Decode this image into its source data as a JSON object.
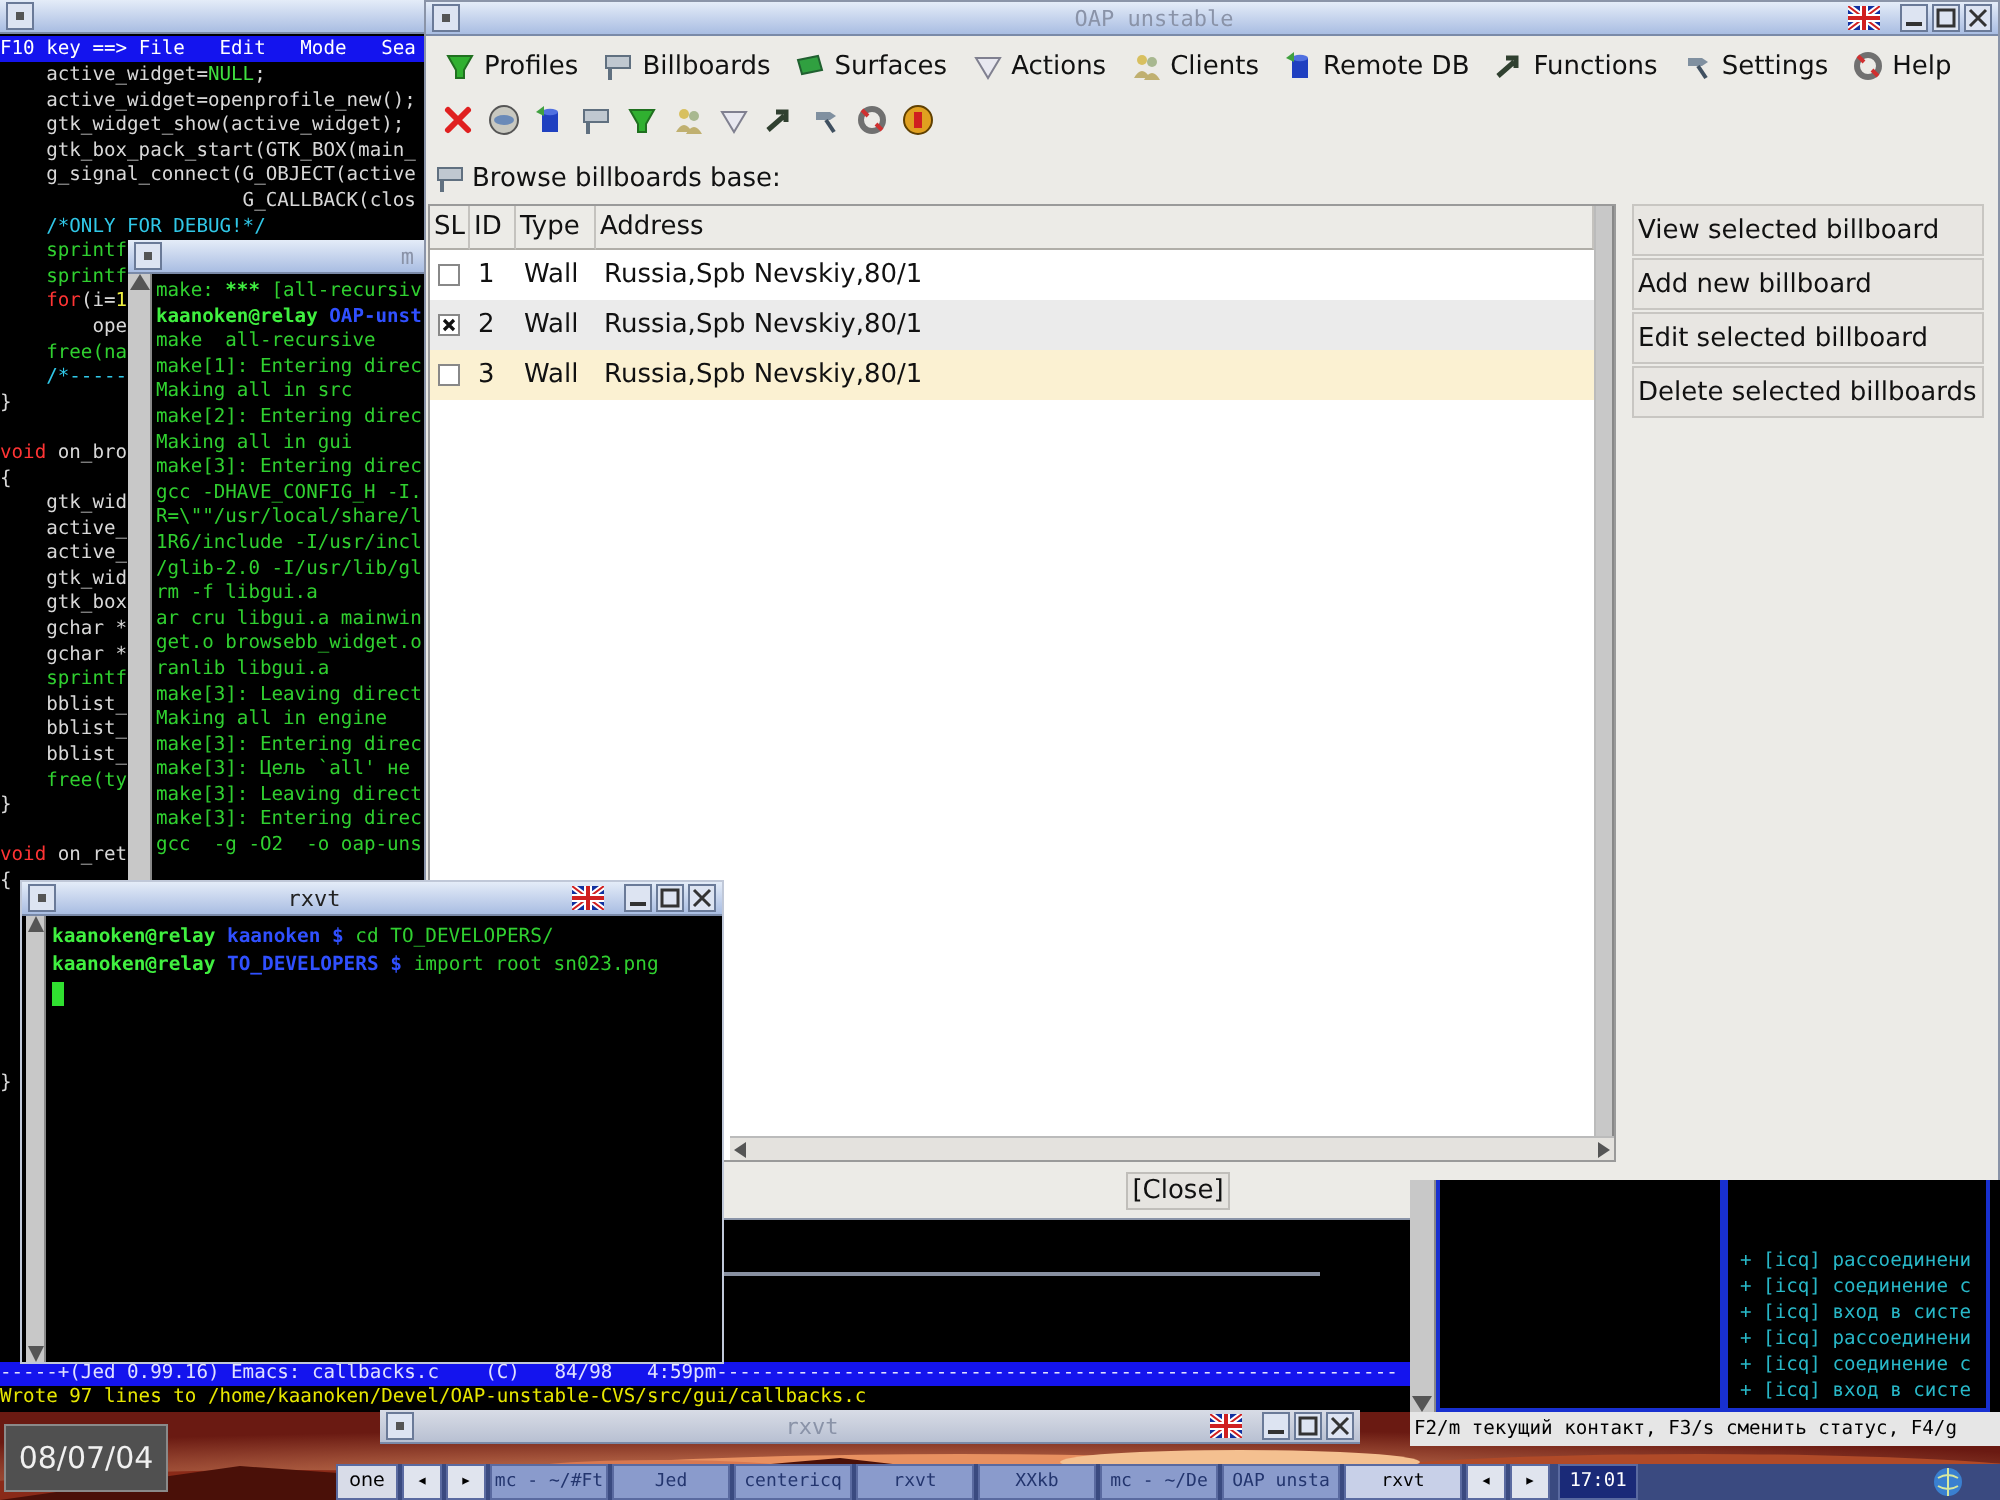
{
  "editor": {
    "menu_prefix": "F10 key ==>",
    "menu": [
      {
        "label": "File"
      },
      {
        "label": "Edit"
      },
      {
        "label": "Mode"
      },
      {
        "label": "Sea"
      }
    ],
    "code_blocks": [
      [
        {
          "parts": [
            {
              "text": "    active_widget=",
              "kind": "plain"
            },
            {
              "text": "NULL",
              "kind": "constant"
            },
            {
              "text": ";",
              "kind": "plain"
            }
          ]
        },
        {
          "parts": [
            {
              "text": "    active_widget=openprofile_new();",
              "kind": "plain"
            }
          ]
        },
        {
          "parts": [
            {
              "text": "    gtk_widget_show(active_widget);",
              "kind": "plain"
            }
          ]
        },
        {
          "parts": [
            {
              "text": "    gtk_box_pack_start(GTK_BOX(main_",
              "kind": "plain"
            }
          ]
        },
        {
          "parts": [
            {
              "text": "    g_signal_connect(G_OBJECT(active",
              "kind": "plain"
            }
          ]
        },
        {
          "parts": [
            {
              "text": "                     G_CALLBACK(clos",
              "kind": "plain"
            }
          ]
        },
        {
          "parts": [
            {
              "text": "    /*ONLY FOR DEBUG!*/",
              "kind": "comment"
            }
          ]
        },
        {
          "parts": [
            {
              "text": "    sprintf",
              "kind": "builtin"
            }
          ]
        },
        {
          "parts": [
            {
              "text": "    sprintf",
              "kind": "builtin"
            }
          ]
        },
        {
          "parts": [
            {
              "text": "    for",
              "kind": "keyword"
            },
            {
              "text": "(i=",
              "kind": "plain"
            },
            {
              "text": "1",
              "kind": "number"
            }
          ]
        },
        {
          "parts": [
            {
              "text": "        ope",
              "kind": "plain"
            }
          ]
        },
        {
          "parts": [
            {
              "text": "    free(na",
              "kind": "builtin"
            }
          ]
        },
        {
          "parts": [
            {
              "text": "    /*-----",
              "kind": "comment"
            }
          ]
        },
        {
          "parts": [
            {
              "text": "}",
              "kind": "plain"
            }
          ]
        }
      ],
      [
        {
          "parts": [
            {
              "text": "void",
              "kind": "keyword"
            },
            {
              "text": " on_bro",
              "kind": "plain"
            }
          ]
        },
        {
          "parts": [
            {
              "text": "{",
              "kind": "plain"
            }
          ]
        },
        {
          "parts": [
            {
              "text": "    gtk_wid",
              "kind": "plain"
            }
          ]
        },
        {
          "parts": [
            {
              "text": "    active_",
              "kind": "plain"
            }
          ]
        },
        {
          "parts": [
            {
              "text": "    active_",
              "kind": "plain"
            }
          ]
        },
        {
          "parts": [
            {
              "text": "    gtk_wid",
              "kind": "plain"
            }
          ]
        },
        {
          "parts": [
            {
              "text": "    gtk_box",
              "kind": "plain"
            }
          ]
        },
        {
          "parts": [
            {
              "text": "    gchar *",
              "kind": "plain"
            }
          ]
        },
        {
          "parts": [
            {
              "text": "    gchar *",
              "kind": "plain"
            }
          ]
        },
        {
          "parts": [
            {
              "text": "    sprintf",
              "kind": "builtin"
            }
          ]
        },
        {
          "parts": [
            {
              "text": "    bblist_",
              "kind": "plain"
            }
          ]
        },
        {
          "parts": [
            {
              "text": "    bblist_",
              "kind": "plain"
            }
          ]
        },
        {
          "parts": [
            {
              "text": "    bblist_",
              "kind": "plain"
            }
          ]
        },
        {
          "parts": [
            {
              "text": "    free(ty",
              "kind": "builtin"
            }
          ]
        },
        {
          "parts": [
            {
              "text": "}",
              "kind": "plain"
            }
          ]
        }
      ],
      [
        {
          "parts": [
            {
              "text": "void",
              "kind": "keyword"
            },
            {
              "text": " on_ret",
              "kind": "plain"
            }
          ]
        },
        {
          "parts": [
            {
              "text": "{",
              "kind": "plain"
            }
          ]
        }
      ],
      [
        {
          "parts": [
            {
              "text": "}",
              "kind": "plain"
            }
          ]
        }
      ]
    ],
    "status_line": "-----+(Jed 0.99.16) Emacs: callbacks.c    (C)   84/98   4:59pm-----------------------------------------------------------",
    "message": "Wrote 97 lines to /home/kaanoken/Devel/OAP-unstable-CVS/src/gui/callbacks.c"
  },
  "make_terminal": {
    "title": "m",
    "lines": [
      {
        "parts": [
          {
            "text": "make: ",
            "kind": "output"
          },
          {
            "text": "***",
            "kind": "bold"
          },
          {
            "text": " [all-recursiv",
            "kind": "output"
          }
        ]
      },
      {
        "parts": [
          {
            "text": "kaanoken@relay",
            "kind": "prompt"
          },
          {
            "text": " OAP-unst",
            "kind": "path"
          }
        ]
      },
      {
        "parts": [
          {
            "text": "make  all-recursive",
            "kind": "output"
          }
        ]
      },
      {
        "parts": [
          {
            "text": "make[1]: Entering direc",
            "kind": "output"
          }
        ]
      },
      {
        "parts": [
          {
            "text": "Making all in src",
            "kind": "output"
          }
        ]
      },
      {
        "parts": [
          {
            "text": "make[2]: Entering direc",
            "kind": "output"
          }
        ]
      },
      {
        "parts": [
          {
            "text": "Making all in gui",
            "kind": "output"
          }
        ]
      },
      {
        "parts": [
          {
            "text": "make[3]: Entering direc",
            "kind": "output"
          }
        ]
      },
      {
        "parts": [
          {
            "text": "gcc -DHAVE_CONFIG_H -I.",
            "kind": "output"
          }
        ]
      },
      {
        "parts": [
          {
            "text": "R=\\\"\"/usr/local/share/l",
            "kind": "output"
          }
        ]
      },
      {
        "parts": [
          {
            "text": "1R6/include -I/usr/incl",
            "kind": "output"
          }
        ]
      },
      {
        "parts": [
          {
            "text": "/glib-2.0 -I/usr/lib/gl",
            "kind": "output"
          }
        ]
      },
      {
        "parts": [
          {
            "text": "rm -f libgui.a",
            "kind": "output"
          }
        ]
      },
      {
        "parts": [
          {
            "text": "ar cru libgui.a mainwin",
            "kind": "output"
          }
        ]
      },
      {
        "parts": [
          {
            "text": "get.o browsebb_widget.o",
            "kind": "output"
          }
        ]
      },
      {
        "parts": [
          {
            "text": "ranlib libgui.a",
            "kind": "output"
          }
        ]
      },
      {
        "parts": [
          {
            "text": "make[3]: Leaving direct",
            "kind": "output"
          }
        ]
      },
      {
        "parts": [
          {
            "text": "Making all in engine",
            "kind": "output"
          }
        ]
      },
      {
        "parts": [
          {
            "text": "make[3]: Entering direc",
            "kind": "output"
          }
        ]
      },
      {
        "parts": [
          {
            "text": "make[3]: Цель `all' не",
            "kind": "output"
          }
        ]
      },
      {
        "parts": [
          {
            "text": "make[3]: Leaving direct",
            "kind": "output"
          }
        ]
      },
      {
        "parts": [
          {
            "text": "make[3]: Entering direc",
            "kind": "output"
          }
        ]
      },
      {
        "parts": [
          {
            "text": "gcc  -g -O2  -o oap-uns",
            "kind": "output"
          }
        ]
      }
    ]
  },
  "oap_window": {
    "title": "OAP unstable",
    "menu": [
      {
        "label": "Profiles"
      },
      {
        "label": "Billboards"
      },
      {
        "label": "Surfaces"
      },
      {
        "label": "Actions"
      },
      {
        "label": "Clients"
      },
      {
        "label": "Remote DB"
      },
      {
        "label": "Functions"
      },
      {
        "label": "Settings"
      },
      {
        "label": "Help"
      }
    ],
    "browse_label": "Browse billboards base:",
    "table": {
      "select_column": "SL",
      "columns": [
        "ID",
        "Type",
        "Address"
      ],
      "rows": [
        {
          "checked": false,
          "selected": false,
          "cells": [
            "1",
            "Wall",
            "Russia,Spb Nevskiy,80/1"
          ]
        },
        {
          "checked": true,
          "selected": false,
          "cells": [
            "2",
            "Wall",
            "Russia,Spb Nevskiy,80/1"
          ]
        },
        {
          "checked": false,
          "selected": true,
          "cells": [
            "3",
            "Wall",
            "Russia,Spb Nevskiy,80/1"
          ]
        }
      ]
    },
    "actions": [
      "View selected billboard",
      "Add new billboard",
      "Edit selected billboard",
      "Delete selected billboards"
    ],
    "close_button": "[Close]"
  },
  "rxvt": {
    "title": "rxvt",
    "lines": [
      {
        "parts": [
          {
            "text": "kaanoken@relay",
            "kind": "prompt"
          },
          {
            "text": " kaanoken $",
            "kind": "path"
          },
          {
            "text": " cd TO_DEVELOPERS/",
            "kind": "output"
          }
        ]
      },
      {
        "parts": [
          {
            "text": "kaanoken@relay",
            "kind": "prompt"
          },
          {
            "text": " TO_DEVELOPERS $",
            "kind": "path"
          },
          {
            "text": " import root sn023.png",
            "kind": "output"
          }
        ]
      }
    ]
  },
  "icq": {
    "log": [
      "+ [icq] рассоединени",
      "+ [icq] соединение с",
      "+ [icq] вход в систе",
      "+ [icq] рассоединени",
      "+ [icq] соединение с",
      "+ [icq] вход в систе"
    ],
    "hint": "F2/m текущий контакт, F3/s сменить статус, F4/g"
  },
  "bottom_window": {
    "title": "rxvt"
  },
  "date": "08/07/04",
  "taskbar": [
    {
      "kind": "pager",
      "label": "one"
    },
    {
      "kind": "arrow",
      "label": "◂"
    },
    {
      "kind": "arrow",
      "label": "▸"
    },
    {
      "kind": "task",
      "label": "mc - ~/#Ft",
      "selected": false
    },
    {
      "kind": "task",
      "label": "Jed",
      "selected": false
    },
    {
      "kind": "task",
      "label": "centericq",
      "selected": false
    },
    {
      "kind": "task",
      "label": "rxvt",
      "selected": false
    },
    {
      "kind": "task",
      "label": "XXkb",
      "selected": false
    },
    {
      "kind": "task",
      "label": "mc - ~/De",
      "selected": false
    },
    {
      "kind": "task",
      "label": "OAP unsta",
      "selected": false
    },
    {
      "kind": "task",
      "label": "rxvt",
      "selected": true
    },
    {
      "kind": "arrow",
      "label": "◂"
    },
    {
      "kind": "arrow",
      "label": "▸"
    },
    {
      "kind": "clock",
      "label": "17:01"
    }
  ]
}
